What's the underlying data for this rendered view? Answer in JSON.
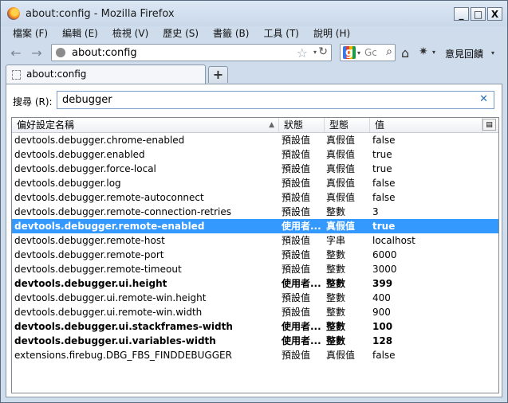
{
  "window": {
    "title": "about:config - Mozilla Firefox",
    "minimize": "_",
    "maximize": "□",
    "close": "X"
  },
  "menu": [
    "檔案 (F)",
    "編輯 (E)",
    "檢視 (V)",
    "歷史 (S)",
    "書籤 (B)",
    "工具 (T)",
    "說明 (H)"
  ],
  "nav": {
    "url": "about:config",
    "search_placeholder": "Gc",
    "feedback": "意見回饋"
  },
  "tabs": [
    {
      "label": "about:config"
    }
  ],
  "newtab": "+",
  "filter": {
    "label": "搜尋 (R):",
    "value": "debugger"
  },
  "columns": {
    "name": "偏好設定名稱",
    "status": "狀態",
    "type": "型態",
    "value": "值"
  },
  "rows": [
    {
      "name": "devtools.debugger.chrome-enabled",
      "status": "預設值",
      "type": "真假值",
      "value": "false"
    },
    {
      "name": "devtools.debugger.enabled",
      "status": "預設值",
      "type": "真假值",
      "value": "true"
    },
    {
      "name": "devtools.debugger.force-local",
      "status": "預設值",
      "type": "真假值",
      "value": "true"
    },
    {
      "name": "devtools.debugger.log",
      "status": "預設值",
      "type": "真假值",
      "value": "false"
    },
    {
      "name": "devtools.debugger.remote-autoconnect",
      "status": "預設值",
      "type": "真假值",
      "value": "false"
    },
    {
      "name": "devtools.debugger.remote-connection-retries",
      "status": "預設值",
      "type": "整數",
      "value": "3"
    },
    {
      "name": "devtools.debugger.remote-enabled",
      "status": "使用者...",
      "type": "真假值",
      "value": "true"
    },
    {
      "name": "devtools.debugger.remote-host",
      "status": "預設值",
      "type": "字串",
      "value": "localhost"
    },
    {
      "name": "devtools.debugger.remote-port",
      "status": "預設值",
      "type": "整數",
      "value": "6000"
    },
    {
      "name": "devtools.debugger.remote-timeout",
      "status": "預設值",
      "type": "整數",
      "value": "3000"
    },
    {
      "name": "devtools.debugger.ui.height",
      "status": "使用者...",
      "type": "整數",
      "value": "399"
    },
    {
      "name": "devtools.debugger.ui.remote-win.height",
      "status": "預設值",
      "type": "整數",
      "value": "400"
    },
    {
      "name": "devtools.debugger.ui.remote-win.width",
      "status": "預設值",
      "type": "整數",
      "value": "900"
    },
    {
      "name": "devtools.debugger.ui.stackframes-width",
      "status": "使用者...",
      "type": "整數",
      "value": "100"
    },
    {
      "name": "devtools.debugger.ui.variables-width",
      "status": "使用者...",
      "type": "整數",
      "value": "128"
    },
    {
      "name": "extensions.firebug.DBG_FBS_FINDDEBUGGER",
      "status": "預設值",
      "type": "真假值",
      "value": "false"
    }
  ],
  "selected_row": 6,
  "bold_rows": [
    6,
    10,
    13,
    14
  ],
  "colors": {
    "selection": "#3399ff",
    "chrome": "#cfdcec"
  }
}
